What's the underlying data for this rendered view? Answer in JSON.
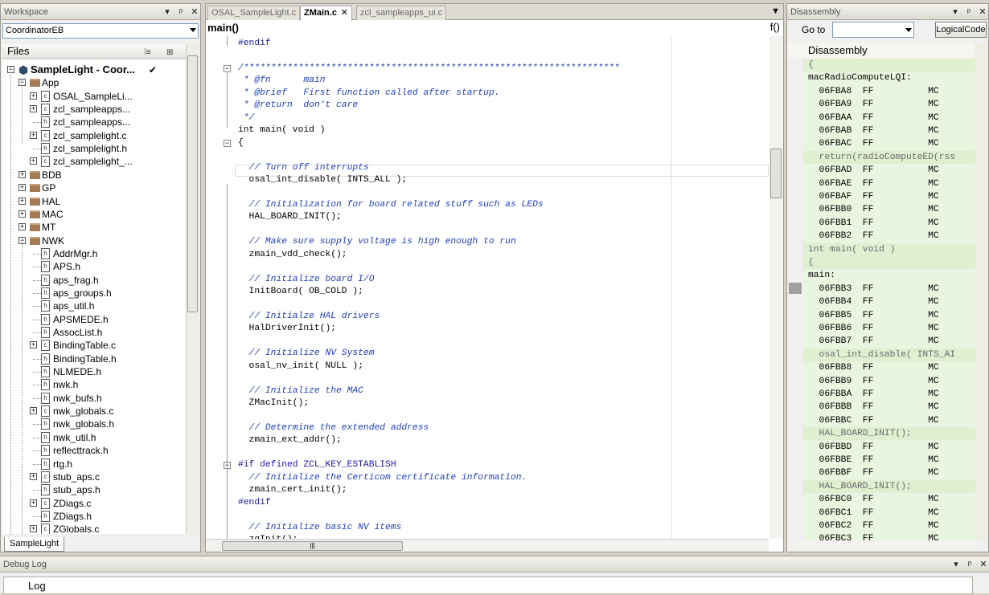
{
  "workspace": {
    "title": "Workspace",
    "config": "CoordinatorEB",
    "files_header": "Files",
    "tab": "SampleLight",
    "tree": [
      {
        "label": "SampleLight - Coor...",
        "level": 0,
        "kind": "project",
        "exp": "−",
        "check": "✔"
      },
      {
        "label": "App",
        "level": 1,
        "kind": "folder",
        "exp": "−"
      },
      {
        "label": "OSAL_SampleLi...",
        "level": 2,
        "kind": "c",
        "exp": "+"
      },
      {
        "label": "zcl_sampleapps...",
        "level": 2,
        "kind": "c",
        "exp": "+"
      },
      {
        "label": "zcl_sampleapps...",
        "level": 2,
        "kind": "h",
        "exp": ""
      },
      {
        "label": "zcl_samplelight.c",
        "level": 2,
        "kind": "c",
        "exp": "+"
      },
      {
        "label": "zcl_samplelight.h",
        "level": 2,
        "kind": "h",
        "exp": ""
      },
      {
        "label": "zcl_samplelight_...",
        "level": 2,
        "kind": "c",
        "exp": "+"
      },
      {
        "label": "BDB",
        "level": 1,
        "kind": "folder",
        "exp": "+"
      },
      {
        "label": "GP",
        "level": 1,
        "kind": "folder",
        "exp": "+"
      },
      {
        "label": "HAL",
        "level": 1,
        "kind": "folder",
        "exp": "+"
      },
      {
        "label": "MAC",
        "level": 1,
        "kind": "folder",
        "exp": "+"
      },
      {
        "label": "MT",
        "level": 1,
        "kind": "folder",
        "exp": "+"
      },
      {
        "label": "NWK",
        "level": 1,
        "kind": "folder",
        "exp": "−"
      },
      {
        "label": "AddrMgr.h",
        "level": 2,
        "kind": "h",
        "exp": ""
      },
      {
        "label": "APS.h",
        "level": 2,
        "kind": "h",
        "exp": ""
      },
      {
        "label": "aps_frag.h",
        "level": 2,
        "kind": "h",
        "exp": ""
      },
      {
        "label": "aps_groups.h",
        "level": 2,
        "kind": "h",
        "exp": ""
      },
      {
        "label": "aps_util.h",
        "level": 2,
        "kind": "h",
        "exp": ""
      },
      {
        "label": "APSMEDE.h",
        "level": 2,
        "kind": "h",
        "exp": ""
      },
      {
        "label": "AssocList.h",
        "level": 2,
        "kind": "h",
        "exp": ""
      },
      {
        "label": "BindingTable.c",
        "level": 2,
        "kind": "c",
        "exp": "+"
      },
      {
        "label": "BindingTable.h",
        "level": 2,
        "kind": "h",
        "exp": ""
      },
      {
        "label": "NLMEDE.h",
        "level": 2,
        "kind": "h",
        "exp": ""
      },
      {
        "label": "nwk.h",
        "level": 2,
        "kind": "h",
        "exp": ""
      },
      {
        "label": "nwk_bufs.h",
        "level": 2,
        "kind": "h",
        "exp": ""
      },
      {
        "label": "nwk_globals.c",
        "level": 2,
        "kind": "c",
        "exp": "+"
      },
      {
        "label": "nwk_globals.h",
        "level": 2,
        "kind": "h",
        "exp": ""
      },
      {
        "label": "nwk_util.h",
        "level": 2,
        "kind": "h",
        "exp": ""
      },
      {
        "label": "reflecttrack.h",
        "level": 2,
        "kind": "h",
        "exp": ""
      },
      {
        "label": "rtg.h",
        "level": 2,
        "kind": "h",
        "exp": ""
      },
      {
        "label": "stub_aps.c",
        "level": 2,
        "kind": "c",
        "exp": "+"
      },
      {
        "label": "stub_aps.h",
        "level": 2,
        "kind": "h",
        "exp": ""
      },
      {
        "label": "ZDiags.c",
        "level": 2,
        "kind": "c",
        "exp": "+"
      },
      {
        "label": "ZDiags.h",
        "level": 2,
        "kind": "h",
        "exp": ""
      },
      {
        "label": "ZGlobals.c",
        "level": 2,
        "kind": "c",
        "exp": "+"
      }
    ]
  },
  "editor": {
    "tabs": [
      {
        "label": "OSAL_SampleLight.c",
        "active": false
      },
      {
        "label": "ZMain.c",
        "active": true
      },
      {
        "label": "zcl_sampleapps_ui.c",
        "active": false
      }
    ],
    "function": "main()",
    "fx": "f()",
    "lines": [
      {
        "t": "#endif",
        "c": "pp"
      },
      {
        "t": "",
        "c": ""
      },
      {
        "t": "/*********************************************************************",
        "c": "cm"
      },
      {
        "t": " * @fn      main",
        "c": "cm"
      },
      {
        "t": " * @brief   First function called after startup.",
        "c": "cm"
      },
      {
        "t": " * @return  don't care",
        "c": "cm"
      },
      {
        "t": " */",
        "c": "cm"
      },
      {
        "t": "int main( void )",
        "c": ""
      },
      {
        "t": "{",
        "c": ""
      },
      {
        "t": "",
        "c": ""
      },
      {
        "t": "  // Turn off interrupts",
        "c": "cm"
      },
      {
        "t": "  osal_int_disable( INTS_ALL );",
        "c": ""
      },
      {
        "t": "",
        "c": ""
      },
      {
        "t": "  // Initialization for board related stuff such as LEDs",
        "c": "cm"
      },
      {
        "t": "  HAL_BOARD_INIT();",
        "c": ""
      },
      {
        "t": "",
        "c": ""
      },
      {
        "t": "  // Make sure supply voltage is high enough to run",
        "c": "cm"
      },
      {
        "t": "  zmain_vdd_check();",
        "c": ""
      },
      {
        "t": "",
        "c": ""
      },
      {
        "t": "  // Initialize board I/O",
        "c": "cm"
      },
      {
        "t": "  InitBoard( OB_COLD );",
        "c": ""
      },
      {
        "t": "",
        "c": ""
      },
      {
        "t": "  // Initialze HAL drivers",
        "c": "cm"
      },
      {
        "t": "  HalDriverInit();",
        "c": ""
      },
      {
        "t": "",
        "c": ""
      },
      {
        "t": "  // Initialize NV System",
        "c": "cm"
      },
      {
        "t": "  osal_nv_init( NULL );",
        "c": ""
      },
      {
        "t": "",
        "c": ""
      },
      {
        "t": "  // Initialize the MAC",
        "c": "cm"
      },
      {
        "t": "  ZMacInit();",
        "c": ""
      },
      {
        "t": "",
        "c": ""
      },
      {
        "t": "  // Determine the extended address",
        "c": "cm"
      },
      {
        "t": "  zmain_ext_addr();",
        "c": ""
      },
      {
        "t": "",
        "c": ""
      },
      {
        "t": "#if defined ZCL_KEY_ESTABLISH",
        "c": "pp"
      },
      {
        "t": "  // Initialize the Certicom certificate information.",
        "c": "cm"
      },
      {
        "t": "  zmain_cert_init();",
        "c": ""
      },
      {
        "t": "#endif",
        "c": "pp"
      },
      {
        "t": "",
        "c": ""
      },
      {
        "t": "  // Initialize basic NV items",
        "c": "cm"
      },
      {
        "t": "  zgInit();",
        "c": ""
      }
    ]
  },
  "disassembly": {
    "title": "Disassembly",
    "goto_label": "Go to",
    "logical_button": "LogicalCode",
    "header": "Disassembly",
    "lines": [
      {
        "t": "{",
        "src": true
      },
      {
        "t": "macRadioComputeLQI:",
        "src": false
      },
      {
        "t": "  06FBA8  FF          MC",
        "src": false
      },
      {
        "t": "  06FBA9  FF          MC",
        "src": false
      },
      {
        "t": "  06FBAA  FF          MC",
        "src": false
      },
      {
        "t": "  06FBAB  FF          MC",
        "src": false
      },
      {
        "t": "  06FBAC  FF          MC",
        "src": false
      },
      {
        "t": "  return(radioComputeED(rss",
        "src": true
      },
      {
        "t": "  06FBAD  FF          MC",
        "src": false
      },
      {
        "t": "  06FBAE  FF          MC",
        "src": false
      },
      {
        "t": "  06FBAF  FF          MC",
        "src": false
      },
      {
        "t": "  06FBB0  FF          MC",
        "src": false
      },
      {
        "t": "  06FBB1  FF          MC",
        "src": false
      },
      {
        "t": "  06FBB2  FF          MC",
        "src": false
      },
      {
        "t": "int main( void )",
        "src": true
      },
      {
        "t": "{",
        "src": true
      },
      {
        "t": "main:",
        "src": false
      },
      {
        "t": "  06FBB3  FF          MC",
        "src": false
      },
      {
        "t": "  06FBB4  FF          MC",
        "src": false
      },
      {
        "t": "  06FBB5  FF          MC",
        "src": false
      },
      {
        "t": "  06FBB6  FF          MC",
        "src": false
      },
      {
        "t": "  06FBB7  FF          MC",
        "src": false
      },
      {
        "t": "  osal_int_disable( INTS_AI",
        "src": true
      },
      {
        "t": "  06FBB8  FF          MC",
        "src": false
      },
      {
        "t": "  06FBB9  FF          MC",
        "src": false
      },
      {
        "t": "  06FBBA  FF          MC",
        "src": false
      },
      {
        "t": "  06FBBB  FF          MC",
        "src": false
      },
      {
        "t": "  06FBBC  FF          MC",
        "src": false
      },
      {
        "t": "  HAL_BOARD_INIT();",
        "src": true
      },
      {
        "t": "  06FBBD  FF          MC",
        "src": false
      },
      {
        "t": "  06FBBE  FF          MC",
        "src": false
      },
      {
        "t": "  06FBBF  FF          MC",
        "src": false
      },
      {
        "t": "  HAL_BOARD_INIT();",
        "src": true
      },
      {
        "t": "  06FBC0  FF          MC",
        "src": false
      },
      {
        "t": "  06FBC1  FF          MC",
        "src": false
      },
      {
        "t": "  06FBC2  FF          MC",
        "src": false
      },
      {
        "t": "  06FBC3  FF          MC",
        "src": false
      }
    ]
  },
  "debug_log": {
    "title": "Debug Log",
    "column": "Log"
  },
  "colors": {
    "comment": "#1f3fbf",
    "preprocessor": "#1a1aa6",
    "disassembly_bg": "#eaf5e0"
  }
}
